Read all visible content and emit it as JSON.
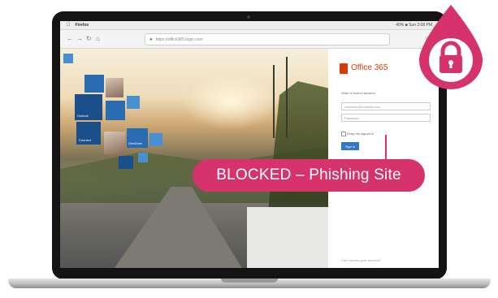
{
  "menubar": {
    "app_name": "Firefox",
    "status_text": "40% ■ Sun 2:08 PM"
  },
  "browser": {
    "nav_back": "←",
    "nav_forward": "→",
    "nav_reload": "↻",
    "nav_home": "⌂",
    "lock_icon": "🔒",
    "url": "https://office365.login.com"
  },
  "hero": {
    "tile_labels": [
      "Outlook",
      "Connect",
      "OneDrive"
    ]
  },
  "signin": {
    "brand": "Office 365",
    "prompt": "Work or school account",
    "email_placeholder": "someone@example.com",
    "password_placeholder": "Password",
    "keep_signed_in": "Keep me signed in",
    "button_label": "Sign in",
    "footer": "Can't access your account?"
  },
  "overlay": {
    "banner_text": "BLOCKED – Phishing Site"
  },
  "colors": {
    "accent": "#d6336c",
    "office_orange": "#d83b01",
    "signin_blue": "#2f78c4"
  },
  "icons": {
    "badge": "padlock-icon",
    "address": "lock-icon"
  }
}
